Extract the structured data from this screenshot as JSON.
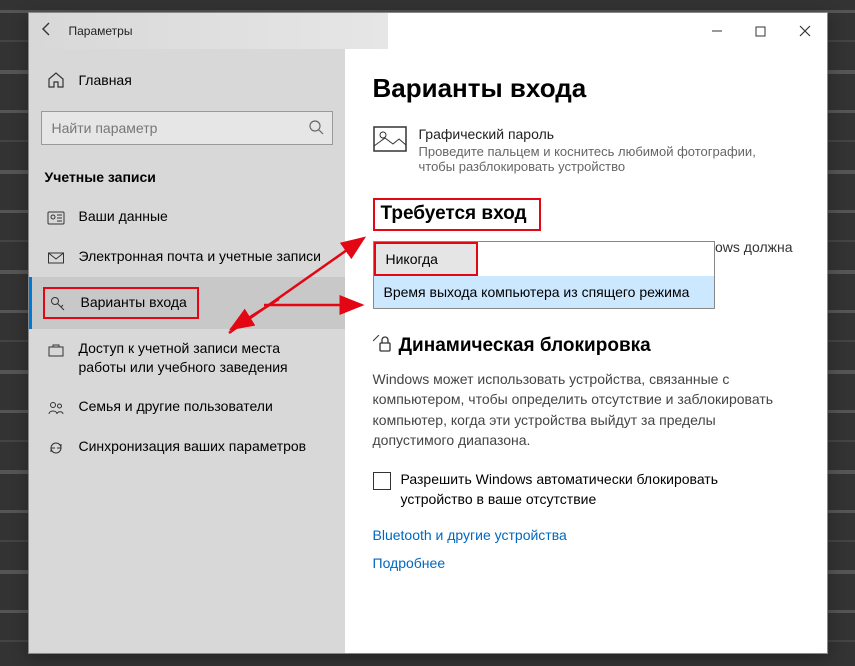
{
  "window": {
    "app_title": "Параметры",
    "home": "Главная",
    "search_placeholder": "Найти параметр",
    "section": "Учетные записи"
  },
  "nav": {
    "items": [
      {
        "label": "Ваши данные"
      },
      {
        "label": "Электронная почта и учетные записи"
      },
      {
        "label": "Варианты входа"
      },
      {
        "label": "Доступ к учетной записи места работы или учебного заведения"
      },
      {
        "label": "Семья и другие пользователи"
      },
      {
        "label": "Синхронизация ваших параметров"
      }
    ]
  },
  "main": {
    "title": "Варианты входа",
    "pic_pass": {
      "title": "Графический пароль",
      "desc": "Проведите пальцем и коснитесь любимой фотографии, чтобы разблокировать устройство"
    },
    "require": {
      "heading": "Требуется вход",
      "label_tail": "Windows должна",
      "dropdown": {
        "selected": "Никогда",
        "option": "Время выхода компьютера из спящего режима"
      }
    },
    "dynamic": {
      "heading": "Динамическая блокировка",
      "desc": "Windows может использовать устройства, связанные с компьютером, чтобы определить отсутствие и заблокировать компьютер, когда эти устройства выйдут за пределы допустимого диапазона.",
      "checkbox": "Разрешить Windows автоматически блокировать устройство в ваше отсутствие",
      "link1": "Bluetooth и другие устройства",
      "link2": "Подробнее"
    }
  }
}
